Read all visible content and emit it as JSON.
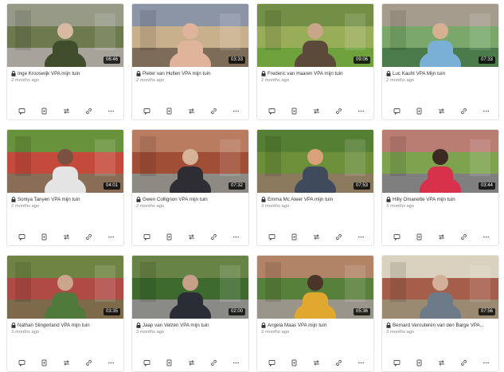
{
  "videos": [
    {
      "title": "Inge Krooswijk VPA mijn tuin",
      "date": "2 months ago",
      "duration": "06:46",
      "scene": {
        "sky": "#cfd6cf",
        "top": "#8c8f7a",
        "mid": "#6d7a4e",
        "ground": "#a7a39a",
        "fig": "#3f4d2c",
        "head": "#d8b9a2"
      }
    },
    {
      "title": "Pieter van Hulten VPA mijn tuin",
      "date": "2 months ago",
      "duration": "03:33",
      "scene": {
        "sky": "#d9d4c8",
        "top": "#7e8aa0",
        "mid": "#c9b08d",
        "ground": "#7d6d58",
        "fig": "#e0b49b",
        "head": "#e0b49b"
      }
    },
    {
      "title": "Frederic van Haaren VPA mijn tuin",
      "date": "2 months ago",
      "duration": "09:06",
      "scene": {
        "sky": "#8ca064",
        "top": "#6f8c3f",
        "mid": "#98ad58",
        "ground": "#6fa23c",
        "fig": "#5b4a3a",
        "head": "#c9a68a"
      }
    },
    {
      "title": "Luc Kauht VPA Mijn tuin",
      "date": "2 months ago",
      "duration": "07:33",
      "scene": {
        "sky": "#e9eef2",
        "top": "#9a8d7b",
        "mid": "#7aa86a",
        "ground": "#4b7a4b",
        "fig": "#7ab0d6",
        "head": "#d7b094"
      }
    },
    {
      "title": "Soniya Tanyeri VPA mijn tuin",
      "date": "2 months ago",
      "duration": "04:01",
      "scene": {
        "sky": "#9fbf6a",
        "top": "#5f8a34",
        "mid": "#c44a3c",
        "ground": "#8a6d57",
        "fig": "#e4e4e4",
        "head": "#7a5140"
      }
    },
    {
      "title": "Gwen Collignon VPA mijn tuin",
      "date": "2 months ago",
      "duration": "07:32",
      "scene": {
        "sky": "#d8d6d2",
        "top": "#b46c4c",
        "mid": "#a14e36",
        "ground": "#8d8a84",
        "fig": "#2d2d33",
        "head": "#d9b29a"
      }
    },
    {
      "title": "Emma Mc Ateer VPA mijn tuin",
      "date": "3 months ago",
      "duration": "07:53",
      "scene": {
        "sky": "#7c9a4c",
        "top": "#4f7a2f",
        "mid": "#6c8f3a",
        "ground": "#8b7a5e",
        "fig": "#3f4b5c",
        "head": "#d9a27a"
      }
    },
    {
      "title": "Hilly Omanette VPA mijn tuin",
      "date": "3 months ago",
      "duration": "03:44",
      "scene": {
        "sky": "#e6e6e6",
        "top": "#b06a5e",
        "mid": "#7da34e",
        "ground": "#7f7f7f",
        "fig": "#d8314b",
        "head": "#3b2a22"
      }
    },
    {
      "title": "Nathan Slingerland VPA mijn tuin",
      "date": "3 months ago",
      "duration": "03:35",
      "scene": {
        "sky": "#8a9a5a",
        "top": "#6a8040",
        "mid": "#b04a44",
        "ground": "#7c6a4a",
        "fig": "#4f7a3c",
        "head": "#cba68c"
      }
    },
    {
      "title": "Jaap van Velzen VPA mijn tuin",
      "date": "3 months ago",
      "duration": "02:00",
      "scene": {
        "sky": "#a9b890",
        "top": "#5c7a3a",
        "mid": "#3e6a2e",
        "ground": "#8a8a86",
        "fig": "#2a2d35",
        "head": "#c7a08a"
      }
    },
    {
      "title": "Angela Maas VPA mijn tuin",
      "date": "3 months ago",
      "duration": "05:36",
      "scene": {
        "sky": "#d9c7ad",
        "top": "#a9785a",
        "mid": "#57803a",
        "ground": "#9a958a",
        "fig": "#e0a82e",
        "head": "#4b3428"
      }
    },
    {
      "title": "Bernard Verouteren van den Barge VPA...",
      "date": "3 months ago",
      "duration": "07:56",
      "scene": {
        "sky": "#eeeeee",
        "top": "#d6cbb6",
        "mid": "#a55e4a",
        "ground": "#9a8a72",
        "fig": "#6d7a88",
        "head": "#d2b09a"
      }
    }
  ],
  "actions": [
    "comment-icon",
    "transcribe-icon",
    "share-icon",
    "link-icon",
    "more-icon"
  ]
}
